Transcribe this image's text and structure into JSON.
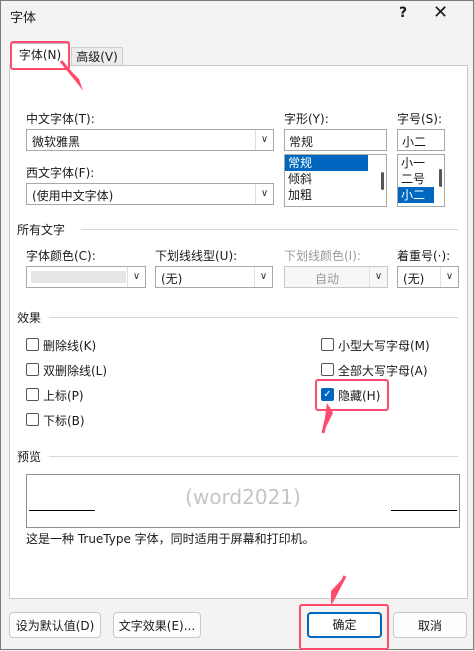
{
  "window": {
    "title": "字体",
    "help": "?",
    "close": "✕"
  },
  "tabs": [
    {
      "label": "字体(N)"
    },
    {
      "label": "高级(V)"
    }
  ],
  "font": {
    "chinese_label": "中文字体(T):",
    "chinese_value": "微软雅黑",
    "western_label": "西文字体(F):",
    "western_value": "(使用中文字体)",
    "style_label": "字形(Y):",
    "style_value": "常规",
    "style_options": [
      "常规",
      "倾斜",
      "加粗"
    ],
    "size_label": "字号(S):",
    "size_value": "小二",
    "size_options": [
      "小一",
      "二号",
      "小二"
    ]
  },
  "all_text": {
    "section": "所有文字",
    "color_label": "字体颜色(C):",
    "underline_label": "下划线线型(U):",
    "underline_value": "(无)",
    "underline_color_label": "下划线颜色(I):",
    "underline_color_value": "自动",
    "emphasis_label": "着重号(·):",
    "emphasis_value": "(无)"
  },
  "effects": {
    "section": "效果",
    "strikethrough": "删除线(K)",
    "double_strikethrough": "双删除线(L)",
    "superscript": "上标(P)",
    "subscript": "下标(B)",
    "small_caps": "小型大写字母(M)",
    "all_caps": "全部大写字母(A)",
    "hidden": "隐藏(H)",
    "hidden_checked": true
  },
  "preview": {
    "section": "预览",
    "sample_text": "(word2021)",
    "description": "这是一种 TrueType 字体，同时适用于屏幕和打印机。"
  },
  "buttons": {
    "set_default": "设为默认值(D)",
    "text_effects": "文字效果(E)...",
    "ok": "确定",
    "cancel": "取消"
  },
  "colors": {
    "accent": "#0067c0",
    "highlight": "#ff4b6e"
  }
}
